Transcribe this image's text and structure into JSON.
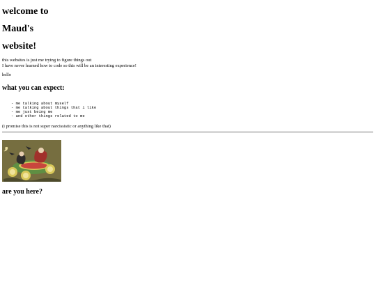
{
  "heading": {
    "line1": "welcome to",
    "line2": "Maud's",
    "line3": "website!"
  },
  "intro": {
    "line1": "this websites is just me trying to figure things out",
    "line2": "I have never learned how to code so this will be an interesting experience!"
  },
  "hello_text": "hello",
  "expect": {
    "heading": "what you can expect:",
    "items": [
      "- me talking about myself",
      "- me talking about things that i like",
      "- me just being me",
      "- and other things related to me"
    ]
  },
  "promise_text": "(i promise this is not super narcissistic or anything like that)",
  "question_heading": "are you here?",
  "colors": {
    "text": "#000000",
    "background": "#ffffff",
    "divider": "#9a9a9a",
    "art_background": "#6f6a3f",
    "art_melon_green": "#5f8f43",
    "art_flesh": "#d9c85a",
    "art_red": "#a1302b"
  },
  "image": {
    "subject": "vintage illustration of a watermelon car with figures riding it"
  }
}
